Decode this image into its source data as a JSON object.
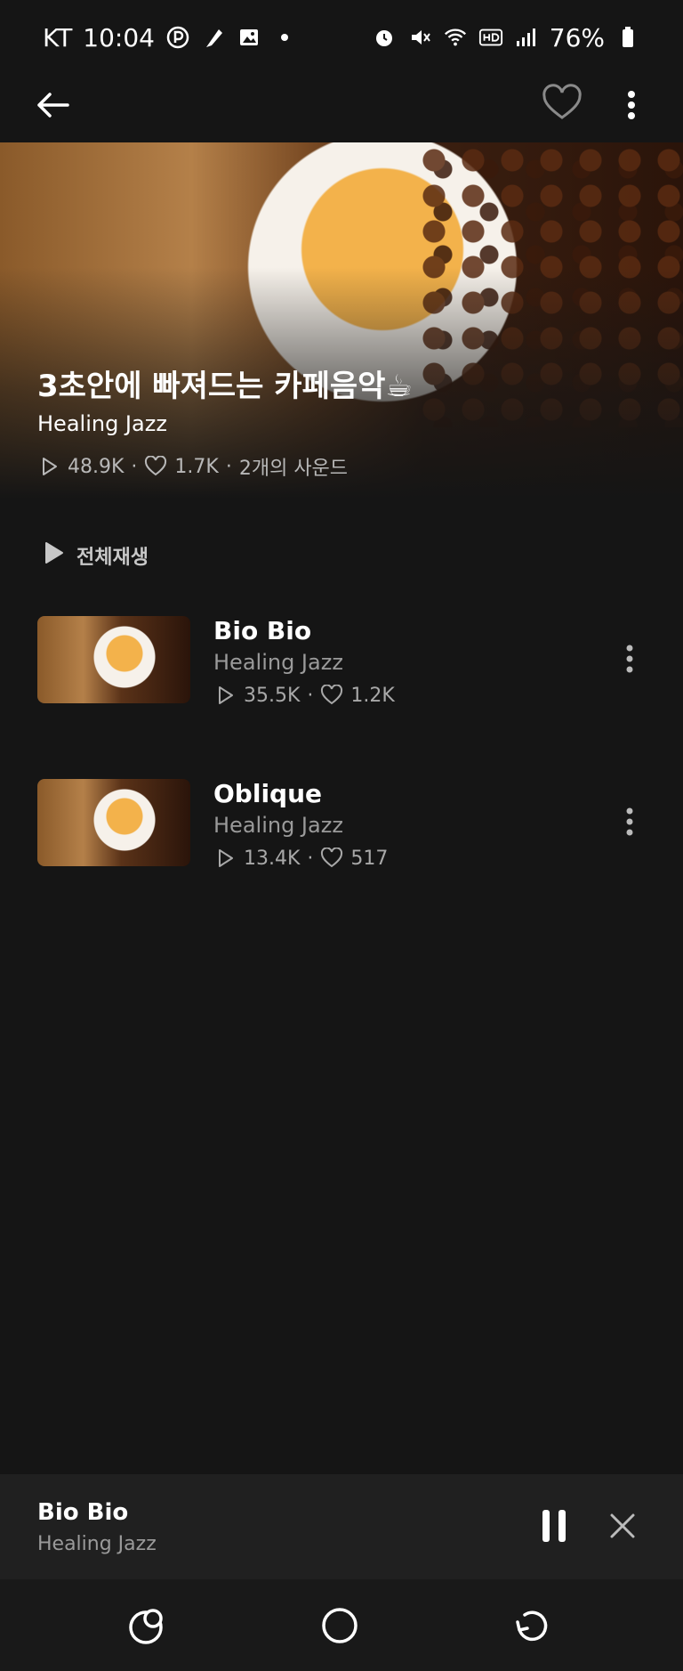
{
  "status_bar": {
    "carrier": "KT",
    "time": "10:04",
    "battery": "76%",
    "left_icons": [
      "p-circle-icon",
      "feather-icon",
      "image-icon",
      "dot-icon"
    ],
    "right_icons": [
      "alarm-icon",
      "mute-icon",
      "wifi-icon",
      "hd-icon",
      "signal-icon",
      "battery-icon"
    ]
  },
  "app_bar": {
    "icons": [
      "back-arrow-icon",
      "heart-icon",
      "more-vertical-icon"
    ]
  },
  "playlist": {
    "title": "3초안에 빠져드는 카페음악☕",
    "artist": "Healing Jazz",
    "plays": "48.9K",
    "likes": "1.7K",
    "sound_count": "2개의 사운드",
    "separator": "·"
  },
  "play_all": {
    "label": "전체재생"
  },
  "tracks": [
    {
      "title": "Bio Bio",
      "artist": "Healing Jazz",
      "plays": "35.5K",
      "likes": "1.2K"
    },
    {
      "title": "Oblique",
      "artist": "Healing Jazz",
      "plays": "13.4K",
      "likes": "517"
    }
  ],
  "mini_player": {
    "title": "Bio Bio",
    "artist": "Healing Jazz",
    "state": "playing"
  },
  "nav_bar": {
    "icons": [
      "recent-apps-icon",
      "home-icon",
      "back-icon"
    ]
  },
  "colors": {
    "background": "#151515",
    "mini_player_bg": "#202020",
    "secondary_text": "#9a9a9a"
  }
}
